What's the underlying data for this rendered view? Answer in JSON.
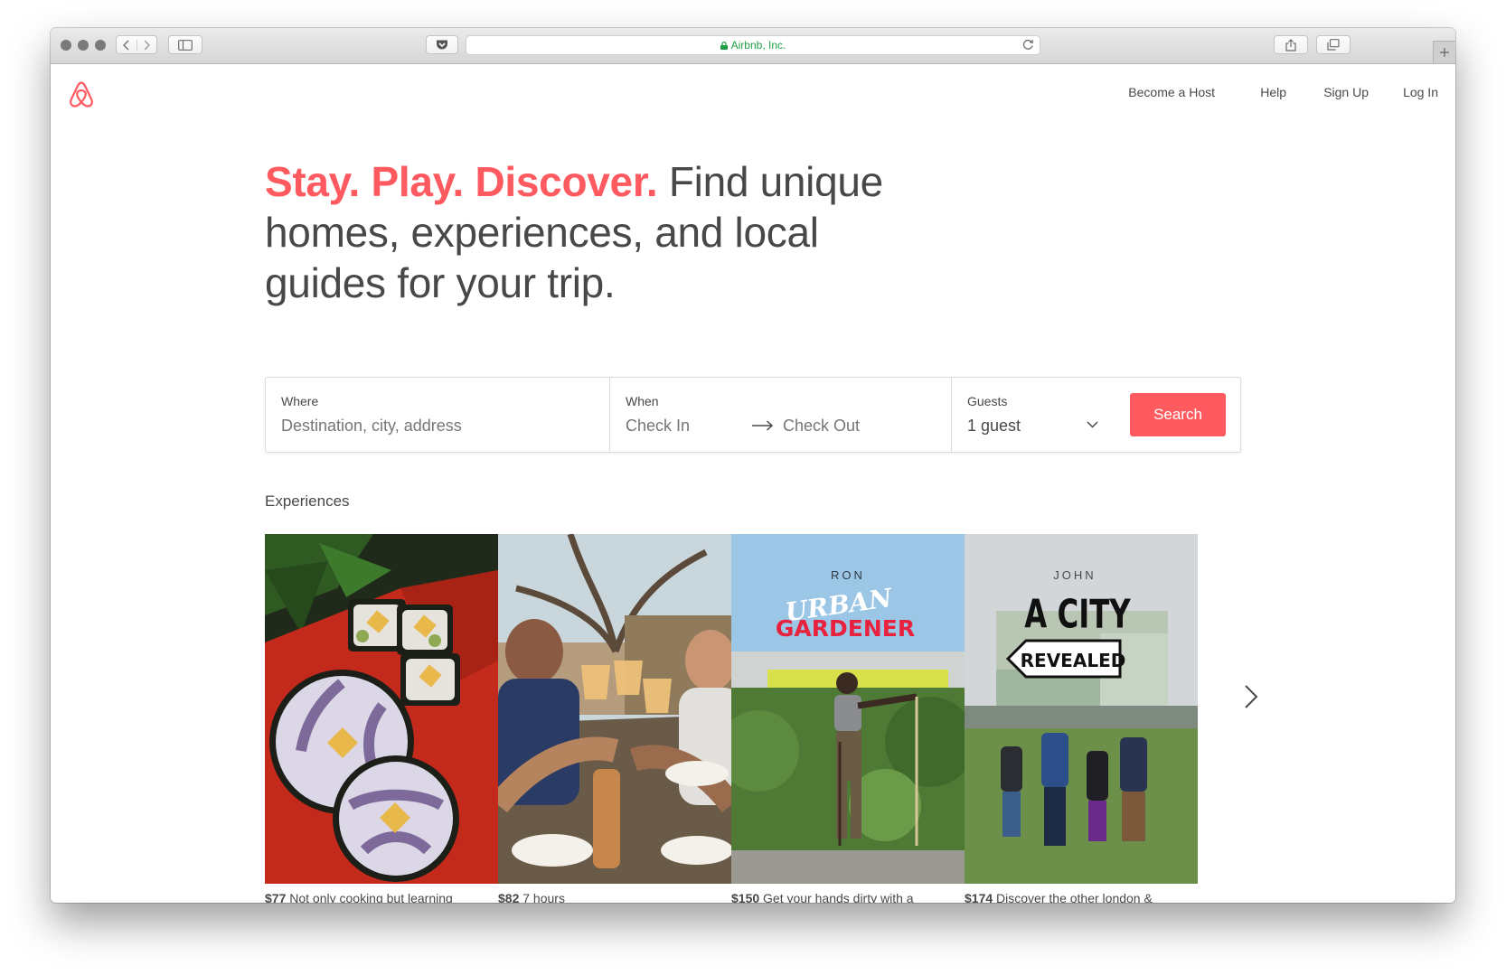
{
  "browser": {
    "url_text": "Airbnb, Inc."
  },
  "nav": {
    "become_host": "Become a Host",
    "help": "Help",
    "sign_up": "Sign Up",
    "log_in": "Log In"
  },
  "hero": {
    "accent": "Stay. Play. Discover.",
    "rest": " Find unique homes, experiences, and local guides for your trip."
  },
  "search": {
    "where_label": "Where",
    "where_placeholder": "Destination, city, address",
    "when_label": "When",
    "check_in": "Check In",
    "check_out": "Check Out",
    "guests_label": "Guests",
    "guests_value": "1 guest",
    "button_label": "Search"
  },
  "experiences": {
    "title": "Experiences",
    "cards": [
      {
        "price": "$77",
        "text": "Not only cooking but learning"
      },
      {
        "price": "$82",
        "text": "7 hours"
      },
      {
        "price": "$150",
        "text": "Get your hands dirty with a"
      },
      {
        "price": "$174",
        "text": "Discover the other london &"
      }
    ],
    "poster_texts": {
      "ron_name": "RON",
      "ron_title_1": "URBAN",
      "ron_title_2": "GARDENER",
      "john_name": "JOHN",
      "john_title_1": "A CITY",
      "john_title_2": "REVEALED"
    }
  },
  "colors": {
    "brand": "#ff5a5f",
    "text": "#484848",
    "secure_green": "#1fa045"
  }
}
